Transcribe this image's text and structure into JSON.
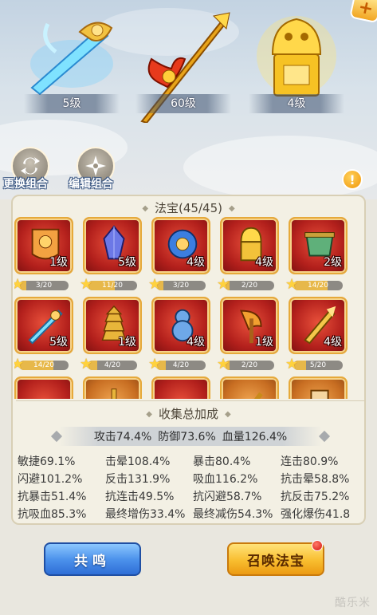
{
  "showcase": {
    "slots": [
      {
        "level": "5级"
      },
      {
        "level": "60级"
      },
      {
        "level": "4级"
      }
    ],
    "swap_label": "更换组合",
    "edit_label": "编辑组合",
    "corner_symbol": "+",
    "info_symbol": "!"
  },
  "treasures": {
    "title": "法宝(45/45)",
    "items": [
      {
        "level": "1级",
        "progress": "3/20",
        "fill": 0.15,
        "color": "red"
      },
      {
        "level": "5级",
        "progress": "11/20",
        "fill": 0.55,
        "color": "red"
      },
      {
        "level": "4级",
        "progress": "3/20",
        "fill": 0.15,
        "color": "red"
      },
      {
        "level": "4级",
        "progress": "2/20",
        "fill": 0.1,
        "color": "red"
      },
      {
        "level": "2级",
        "progress": "14/20",
        "fill": 0.7,
        "color": "red"
      },
      {
        "level": "5级",
        "progress": "14/20",
        "fill": 0.7,
        "color": "red"
      },
      {
        "level": "1级",
        "progress": "4/20",
        "fill": 0.2,
        "color": "red"
      },
      {
        "level": "4级",
        "progress": "4/20",
        "fill": 0.2,
        "color": "red"
      },
      {
        "level": "1级",
        "progress": "2/20",
        "fill": 0.1,
        "color": "red"
      },
      {
        "level": "4级",
        "progress": "5/20",
        "fill": 0.25,
        "color": "red"
      },
      {
        "level": "",
        "progress": "",
        "fill": 0,
        "color": "red"
      },
      {
        "level": "",
        "progress": "",
        "fill": 0,
        "color": "orange"
      },
      {
        "level": "",
        "progress": "",
        "fill": 0,
        "color": "red"
      },
      {
        "level": "",
        "progress": "",
        "fill": 0,
        "color": "orange"
      },
      {
        "level": "",
        "progress": "",
        "fill": 0,
        "color": "orange"
      }
    ]
  },
  "collection": {
    "title": "收集总加成",
    "main": [
      "攻击74.4%",
      "防御73.6%",
      "血量126.4%"
    ],
    "stats": [
      [
        "敏捷69.1%",
        "击晕108.4%",
        "暴击80.4%",
        "连击80.9%"
      ],
      [
        "闪避101.2%",
        "反击131.9%",
        "吸血116.2%",
        "抗击晕58.8%"
      ],
      [
        "抗暴击51.4%",
        "抗连击49.5%",
        "抗闪避58.7%",
        "抗反击75.2%"
      ],
      [
        "抗吸血85.3%",
        "最终增伤33.4%",
        "最终减伤54.3%",
        "强化爆伤41.8"
      ]
    ]
  },
  "buttons": {
    "resonate": "共鸣",
    "summon": "召唤法宝"
  },
  "watermark": "酷乐米",
  "colors": {
    "card_red": "#b3201c",
    "card_border": "#e6a93a",
    "button_blue": "#4d93ec",
    "button_gold": "#f8bd2f",
    "notification_red": "#d4140c"
  }
}
